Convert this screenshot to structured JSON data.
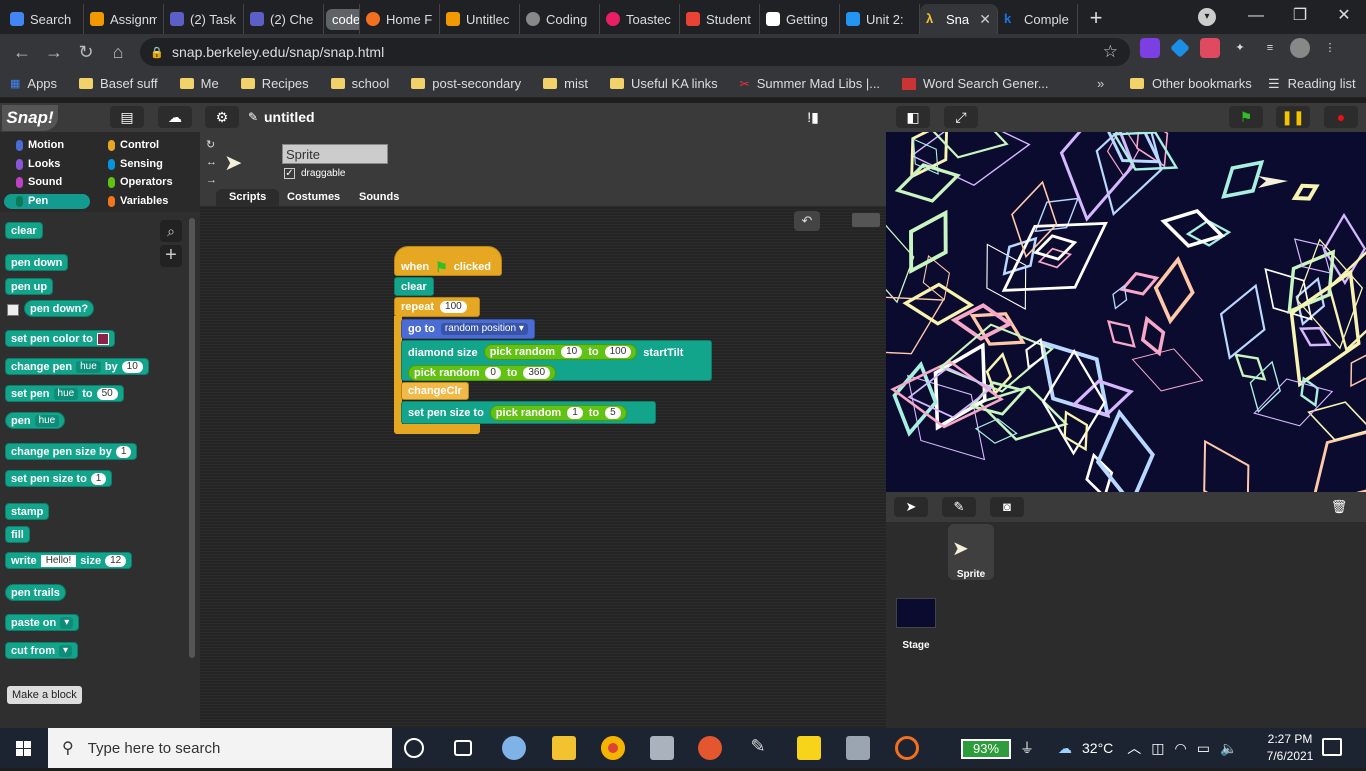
{
  "browser": {
    "tabs": [
      {
        "label": "Search",
        "color": "#4285f4"
      },
      {
        "label": "Assignm",
        "color": "#f29900"
      },
      {
        "label": "(2) Task",
        "color": "#5b5fc7"
      },
      {
        "label": "(2) Che",
        "color": "#5b5fc7"
      },
      {
        "label": "code",
        "color": "#5f6368"
      },
      {
        "label": "Home F",
        "color": "#f37021"
      },
      {
        "label": "Untitlec",
        "color": "#f29900"
      },
      {
        "label": "Coding",
        "color": "#888888"
      },
      {
        "label": "Toastec",
        "color": "#e91e63"
      },
      {
        "label": "Student",
        "color": "#ea4335"
      },
      {
        "label": "Getting",
        "color": "#ffffff"
      },
      {
        "label": "Unit 2:",
        "color": "#2196f3"
      },
      {
        "label": "Sna",
        "color": "#f4c430"
      },
      {
        "label": "Comple",
        "color": "#1a73e8"
      }
    ],
    "new_tab": "+",
    "url": "snap.berkeley.edu/snap/snap.html",
    "bookmarks": [
      "Apps",
      "Basef suff",
      "Me",
      "Recipes",
      "school",
      "post-secondary",
      "mist",
      "Useful KA links",
      "Summer Mad Libs |...",
      "Word Search Gener..."
    ],
    "bookmarks_more": "»",
    "other_bookmarks": "Other bookmarks",
    "reading_list": "Reading list"
  },
  "snap": {
    "logo": "Snap!",
    "project_title": "untitled",
    "categories": [
      {
        "label": "Motion",
        "color": "#4a6cd4"
      },
      {
        "label": "Control",
        "color": "#e6a822"
      },
      {
        "label": "Looks",
        "color": "#8a55d7"
      },
      {
        "label": "Sensing",
        "color": "#0494dc"
      },
      {
        "label": "Sound",
        "color": "#bb42c3"
      },
      {
        "label": "Operators",
        "color": "#62c213"
      },
      {
        "label": "Pen",
        "color": "#0e9a6c"
      },
      {
        "label": "Variables",
        "color": "#f3761d"
      }
    ],
    "palette": {
      "clear": "clear",
      "pen_down": "pen down",
      "pen_up": "pen up",
      "pen_down_q": "pen down?",
      "set_pen_color_to": "set pen color to",
      "change_pen": "change pen",
      "hue": "hue",
      "by": "by",
      "change_by_val": "10",
      "set_pen": "set pen",
      "to": "to",
      "set_to_val": "50",
      "pen": "pen",
      "change_pen_size_by": "change pen size by",
      "change_size_val": "1",
      "set_pen_size_to": "set pen size to",
      "set_size_val": "1",
      "stamp": "stamp",
      "fill": "fill",
      "write": "write",
      "write_text": "Hello!",
      "size": "size",
      "write_size": "12",
      "pen_trails": "pen trails",
      "paste_on": "paste on",
      "cut_from": "cut from",
      "make_a_block": "Make a block"
    },
    "sprite": {
      "name": "Sprite",
      "draggable": "draggable",
      "tabs": [
        "Scripts",
        "Costumes",
        "Sounds"
      ]
    },
    "script": {
      "when": "when",
      "clicked": "clicked",
      "clear": "clear",
      "repeat": "repeat",
      "repeat_count": "100",
      "go_to": "go to",
      "random_position": "random position",
      "diamond_size": "diamond size",
      "pick_random": "pick random",
      "to": "to",
      "size_min": "10",
      "size_max": "100",
      "start_tilt": "startTilt",
      "tilt_min": "0",
      "tilt_max": "360",
      "change_clr": "changeClr",
      "set_pen_size_to": "set pen size to",
      "pen_min": "1",
      "pen_max": "5"
    },
    "corral": {
      "sprite_label": "Sprite",
      "stage_label": "Stage"
    }
  },
  "taskbar": {
    "search_placeholder": "Type here to search",
    "battery": "93%",
    "temperature": "32°C",
    "time": "2:27 PM",
    "date": "7/6/2021"
  }
}
